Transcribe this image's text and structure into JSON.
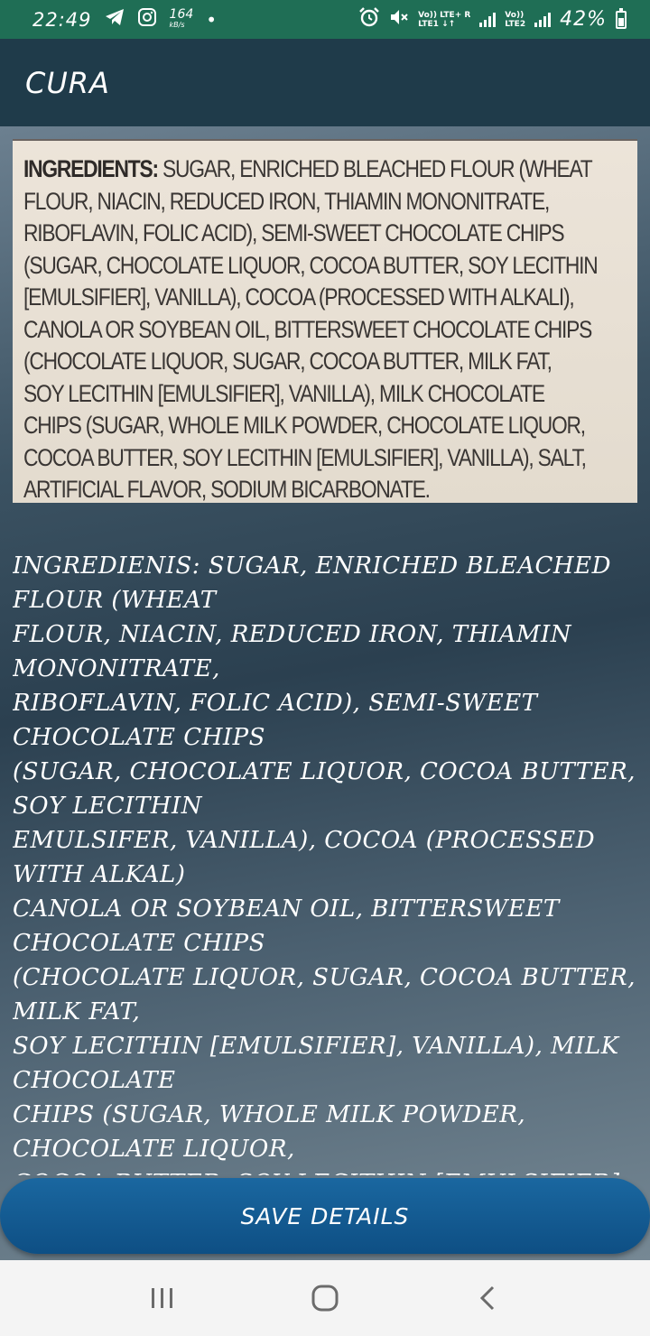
{
  "status_bar": {
    "time": "22:49",
    "speed_value": "164",
    "speed_unit": "kB/s",
    "dot": "•",
    "net1": "Vo)) LTE+ R",
    "net1_sub": "LTE1 ↓↑",
    "net2": "Vo))",
    "net2_sub": "LTE2",
    "battery": "42%",
    "icons": [
      "telegram-icon",
      "instagram-icon",
      "alarm-icon",
      "mute-icon",
      "signal-icon",
      "battery-icon"
    ]
  },
  "app_bar": {
    "title": "CURA"
  },
  "photo": {
    "label_heading": "INGREDIENTS:",
    "label_lines": [
      " SUGAR, ENRICHED BLEACHED FLOUR (WHEAT",
      "FLOUR, NIACIN, REDUCED IRON, THIAMIN MONONITRATE,",
      "RIBOFLAVIN, FOLIC ACID), SEMI-SWEET CHOCOLATE CHIPS",
      "(SUGAR, CHOCOLATE LIQUOR, COCOA BUTTER, SOY LECITHIN",
      "[EMULSIFIER], VANILLA), COCOA (PROCESSED WITH ALKALI),",
      "CANOLA OR SOYBEAN OIL, BITTERSWEET CHOCOLATE CHIPS",
      "(CHOCOLATE LIQUOR, SUGAR, COCOA BUTTER, MILK FAT,",
      "SOY LECITHIN [EMULSIFIER], VANILLA), MILK CHOCOLATE",
      "CHIPS (SUGAR, WHOLE MILK POWDER, CHOCOLATE LIQUOR,",
      "COCOA BUTTER, SOY LECITHIN [EMULSIFIER], VANILLA), SALT,",
      "ARTIFICIAL FLAVOR, SODIUM BICARBONATE."
    ]
  },
  "ocr": {
    "text": "INGREDIENIS: SUGAR, ENRICHED BLEACHED FLOUR (WHEAT\nFLOUR, NIACIN, REDUCED IRON, THIAMIN MONONITRATE,\nRIBOFLAVIN, FOLIC ACID), SEMI-SWEET CHOCOLATE CHIPS\n(SUGAR, CHOCOLATE LIQUOR, COCOA BUTTER, SOY LECITHIN\nEMULSIFER, VANILLA), COCOA (PROCESSED WITH ALKAL)\nCANOLA OR SOYBEAN OIL, BITTERSWEET CHOCOLATE CHIPS\n(CHOCOLATE LIQUOR, SUGAR, COCOA BUTTER, MILK FAT,\nSOY LECITHIN [EMULSIFIER], VANILLA), MILK CHOCOLATE\nCHIPS (SUGAR, WHOLE MILK POWDER, CHOCOLATE LIQUOR,\nCOCOA BUTTER, SOY LECITHIN [EMULSIFIER], VANILLA), SALT,"
  },
  "actions": {
    "save_label": "SAVE DETAILS"
  },
  "nav_bar": {
    "icons": [
      "recents-icon",
      "home-icon",
      "back-icon"
    ]
  }
}
